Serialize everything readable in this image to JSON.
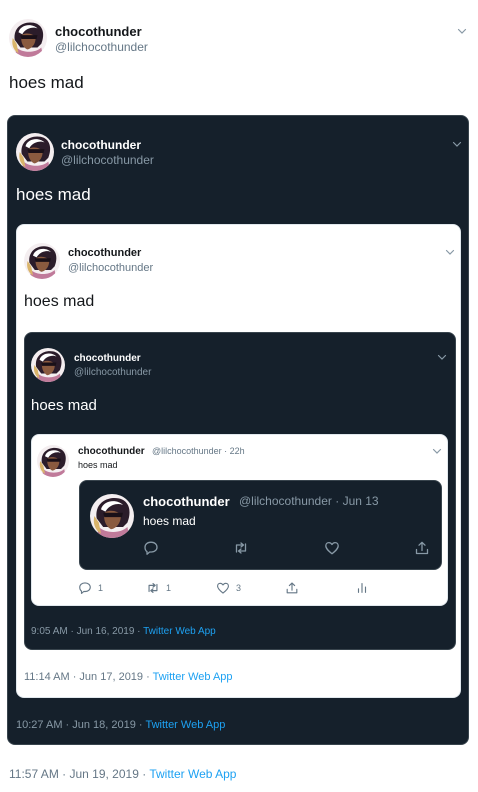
{
  "tweet": {
    "name": "chocothunder",
    "handle": "@lilchocothunder",
    "text": "hoes mad",
    "meta_prefix": "11:57 AM · Jun 19, 2019 · ",
    "source": "Twitter Web App"
  },
  "quote1": {
    "name": "chocothunder",
    "handle": "@lilchocothunder",
    "text": "hoes mad",
    "meta_prefix": "10:27 AM · Jun 18, 2019 · ",
    "source": "Twitter Web App"
  },
  "quote2": {
    "name": "chocothunder",
    "handle": "@lilchocothunder",
    "text": "hoes mad",
    "meta_prefix": "11:14 AM · Jun 17, 2019 · ",
    "source": "Twitter Web App"
  },
  "quote3": {
    "name": "chocothunder",
    "handle": "@lilchocothunder",
    "text": "hoes mad",
    "meta_prefix": "9:05 AM · Jun 16, 2019 · ",
    "source": "Twitter Web App"
  },
  "quote4": {
    "name": "chocothunder",
    "handle": "@lilchocothunder · 22h",
    "text": "hoes mad",
    "reply_count": "1",
    "retweet_count": "1",
    "like_count": "3"
  },
  "quote5": {
    "name": "chocothunder",
    "handle": "@lilchocothunder · Jun 13",
    "text": "hoes mad"
  },
  "colors": {
    "dark_bg": "#15202b",
    "link": "#1da1f2",
    "light_muted": "#657786",
    "dark_muted": "#8899a6"
  },
  "icons": [
    "chevron-down-icon",
    "reply-icon",
    "retweet-icon",
    "like-icon",
    "share-icon",
    "analytics-icon"
  ]
}
